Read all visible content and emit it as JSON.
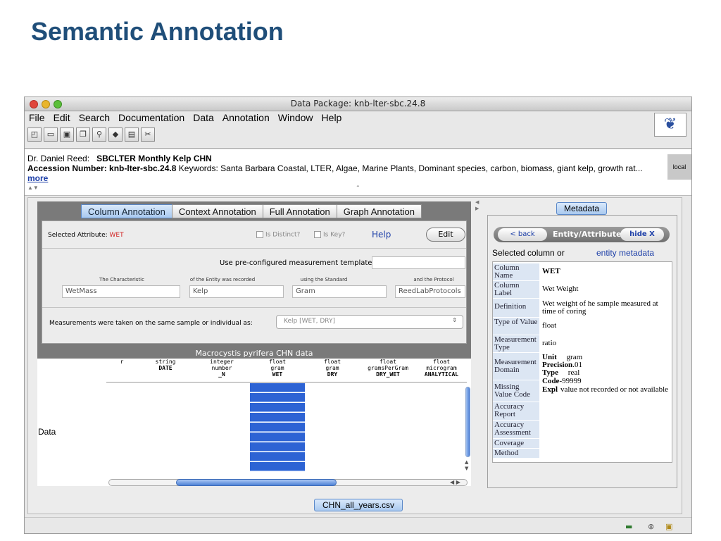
{
  "slide": {
    "title": "Semantic Annotation"
  },
  "window": {
    "title": "Data Package: knb-lter-sbc.24.8"
  },
  "menu": [
    "File",
    "Edit",
    "Search",
    "Documentation",
    "Data",
    "Annotation",
    "Window",
    "Help"
  ],
  "toolbar_icons": [
    "new-document-icon",
    "open-folder-icon",
    "save-icon",
    "copy-icon",
    "search-icon",
    "diamond-icon",
    "print-icon",
    "scissors-icon"
  ],
  "info": {
    "author": "Dr. Daniel Reed:",
    "package_title": "SBCLTER Monthly Kelp CHN",
    "accession_label": "Accession Number:",
    "accession_value": "knb-lter-sbc.24.8",
    "keywords_label": "Keywords:",
    "keywords": "Santa Barbara Coastal, LTER, Algae, Marine Plants, Dominant species, carbon, biomass, giant kelp, growth rat...",
    "more": "more",
    "local": "local"
  },
  "tabs": [
    "Column Annotation",
    "Context Annotation",
    "Full Annotation",
    "Graph Annotation"
  ],
  "annotation": {
    "selected_label": "Selected Attribute:",
    "selected_value": "WET",
    "is_distinct": "Is Distinct?",
    "is_key": "Is Key?",
    "help": "Help",
    "edit": "Edit",
    "template_label": "Use pre-configured measurement template:",
    "characteristic_label": "The Characteristic",
    "entity_label": "of the Entity was recorded",
    "standard_label": "using the Standard",
    "protocol_label": "and the Protocol",
    "characteristic": "WetMass",
    "entity": "Kelp",
    "standard": "Gram",
    "protocol": "ReedLabProtocols",
    "measurement_label": "Measurements were taken on the same sample or individual as:",
    "measurement_value": "Kelp [WET, DRY]"
  },
  "table": {
    "title": "Macrocystis pyrifera CHN data",
    "data_label": "Data",
    "columns": [
      {
        "l1": "r",
        "l2": "",
        "l3": ""
      },
      {
        "l1": "string",
        "l2": "",
        "l3": "DATE"
      },
      {
        "l1": "integer",
        "l2": "number",
        "l3": "_N"
      },
      {
        "l1": "float",
        "l2": "gram",
        "l3": "WET"
      },
      {
        "l1": "float",
        "l2": "gram",
        "l3": "DRY"
      },
      {
        "l1": "float",
        "l2": "gramsPerGram",
        "l3": "DRY_WET"
      },
      {
        "l1": "float",
        "l2": "microgram",
        "l3": "ANALYTICAL"
      }
    ]
  },
  "metadata": {
    "tab": "Metadata",
    "back": "< back",
    "nav_title": "Entity/Attribute",
    "hide": "hide X",
    "selected_column": "Selected column or",
    "entity_metadata": "entity metadata",
    "column_name_label": "Column Name",
    "column_name": "WET",
    "column_label_label": "Column Label",
    "column_label": "Wet Weight",
    "definition_label": "Definition",
    "definition": "Wet weight of he sample measured at time of coring",
    "type_label": "Type of Value",
    "type_value": "float",
    "measurement_type_label": "Measurement Type",
    "measurement_type": "ratio",
    "measurement_domain_label": "Measurement Domain",
    "unit_label": "Unit",
    "unit": "gram",
    "precision_label": "Precision",
    "precision": ".01",
    "type_inner_label": "Type",
    "type_inner": "real",
    "missing_label": "Missing Value Code",
    "code_label": "Code",
    "code": "-99999",
    "expl_label": "Expl",
    "expl": "value not recorded or not available",
    "accuracy_label": "Accuracy Report",
    "assessment_label": "Accuracy Assessment",
    "coverage_label": "Coverage",
    "method_label": "Method"
  },
  "file_tab": "CHN_all_years.csv",
  "status_icons": [
    "network-icon",
    "close-circle-icon",
    "lock-icon"
  ]
}
